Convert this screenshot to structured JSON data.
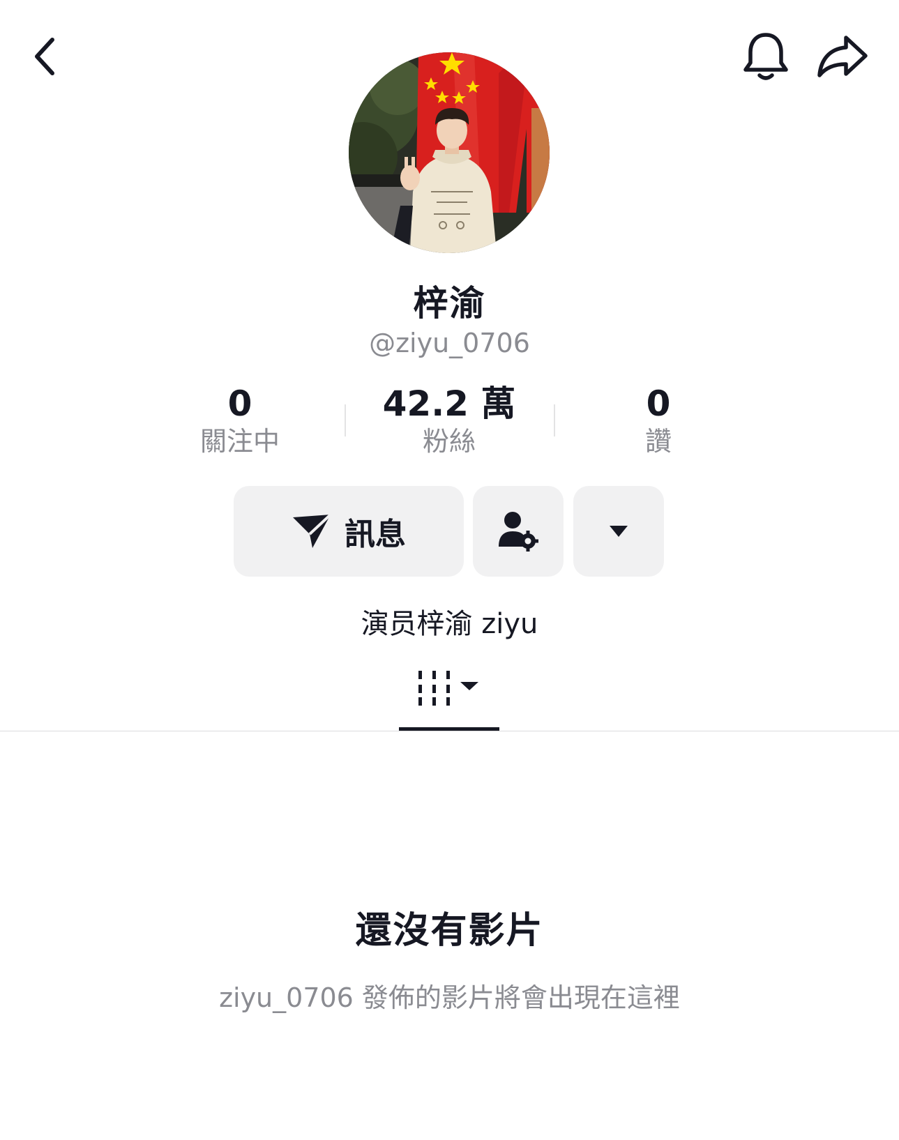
{
  "header": {
    "back_icon": "chevron-left-icon",
    "bell_icon": "bell-icon",
    "share_icon": "share-arrow-icon"
  },
  "profile": {
    "display_name": "梓渝",
    "username": "@ziyu_0706",
    "bio": "演员梓渝 ziyu"
  },
  "stats": [
    {
      "value": "0",
      "label": "關注中"
    },
    {
      "value": "42.2 萬",
      "label": "粉絲"
    },
    {
      "value": "0",
      "label": "讚"
    }
  ],
  "actions": {
    "message_label": "訊息",
    "message_icon": "send-icon",
    "friend_icon": "user-settings-icon",
    "more_icon": "caret-down-icon"
  },
  "tabs": {
    "videos_icon": "video-grid-icon"
  },
  "empty_state": {
    "title": "還沒有影片",
    "description": "ziyu_0706 發佈的影片將會出現在這裡"
  },
  "colors": {
    "text_primary": "#161823",
    "text_secondary": "#8a8b91",
    "button_bg": "#f1f1f2",
    "flag_red": "#d8201e",
    "flag_star": "#ffde00"
  }
}
